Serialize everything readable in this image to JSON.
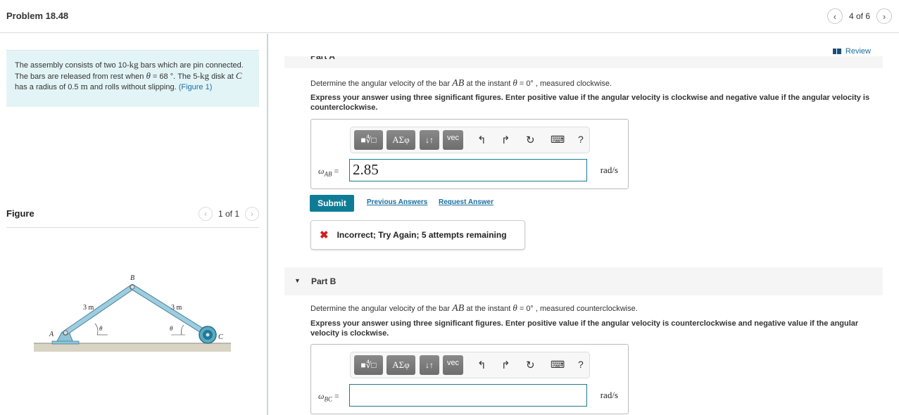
{
  "header": {
    "problem_title": "Problem 18.48",
    "prev_icon": "‹",
    "next_icon": "›",
    "page_counter": "4 of 6"
  },
  "intro": {
    "text_1": "The assembly consists of two 10-",
    "unit_kg": "kg",
    "text_2": " bars which are pin connected. The bars are released from rest when ",
    "theta": "θ",
    "text_3": " = 68 °. The 5-",
    "unit_kg2": "kg",
    "text_4": " disk at ",
    "point_c": "C",
    "text_5": " has a radius of 0.5 ",
    "unit_m": "m",
    "text_6": " and rolls without slipping. ",
    "figure_link": "(Figure 1)"
  },
  "figure": {
    "title": "Figure",
    "prev_icon": "‹",
    "next_icon": "›",
    "counter": "1 of 1",
    "labels": {
      "a": "A",
      "b": "B",
      "c": "C",
      "len_ab": "3 m",
      "len_bc": "3 m",
      "theta_left": "θ",
      "theta_right": "θ"
    }
  },
  "review": {
    "label": "Review"
  },
  "part_a": {
    "header_partial": "Part A",
    "question_1": "Determine the angular velocity of the bar ",
    "bar": "AB",
    "question_2": " at the instant ",
    "theta": "θ",
    "question_3": " = 0° , measured clockwise.",
    "instructions": "Express your answer using three significant figures. Enter positive value if the angular velocity is clockwise and negative value if the angular velocity is counterclockwise.",
    "variable": "ω",
    "variable_sub": "AB",
    "equals": " =",
    "answer_value": "2.85",
    "unit": "rad/s",
    "submit_label": "Submit",
    "previous_answers": "Previous Answers",
    "request_answer": "Request Answer",
    "feedback_icon": "✖",
    "feedback": "Incorrect; Try Again; 5 attempts remaining"
  },
  "part_b": {
    "header": "Part B",
    "toggle_icon": "▼",
    "question_1": "Determine the angular velocity of the bar ",
    "bar": "AB",
    "question_2": " at the instant ",
    "theta": "θ",
    "question_3": " = 0° , measured counterclockwise.",
    "instructions": "Express your answer using three significant figures. Enter positive value if the angular velocity is counterclockwise and negative value if the angular velocity is clockwise.",
    "variable": "ω",
    "variable_sub": "BC",
    "equals": " =",
    "answer_value": "",
    "unit": "rad/s"
  },
  "toolbar": {
    "templates_icon": "■∜□",
    "greek_label": "ΑΣφ",
    "arrows_icon": "↓↑",
    "vec_label": "vec",
    "undo_icon": "↰",
    "redo_icon": "↱",
    "reset_icon": "↻",
    "keyboard_icon": "⌨",
    "help_icon": "?"
  }
}
